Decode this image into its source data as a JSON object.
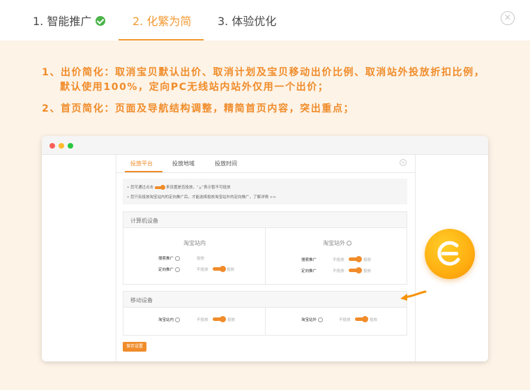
{
  "steps": [
    {
      "label": "1. 智能推广",
      "state": "done"
    },
    {
      "label": "2. 化繁为简",
      "state": "active"
    },
    {
      "label": "3. 体验优化",
      "state": "pending"
    }
  ],
  "close_glyph": "×",
  "description": {
    "line1": "1、出价简化：取消宝贝默认出价、取消计划及宝贝移动出价比例、取消站外投放折扣比例，",
    "line1_cont": "默认使用100%，定向PC无线站内站外仅用一个出价；",
    "line2": "2、首页简化：页面及导航结构调整，精简首页内容，突出重点；"
  },
  "panel": {
    "tabs": [
      "投放平台",
      "投放地域",
      "投放时间"
    ],
    "active_tab": 0,
    "notice": {
      "line1_a": "您可通过点击",
      "line1_b": "来设置是否投放，“",
      "line1_c": "”表示暂不可投放",
      "line2": "您只有投放淘宝站内的定向推广后，才能选择投放淘宝站外的定向推广，了解详情 >>"
    },
    "pc_section": {
      "title": "计算机设备",
      "left_title": "淘宝站内",
      "right_title": "淘宝站外",
      "left_rows": [
        {
          "label": "搜索推广",
          "off": "",
          "on": "投放"
        },
        {
          "label": "定向推广",
          "off": "不投放",
          "on": "投放"
        }
      ],
      "right_rows": [
        {
          "label": "搜索推广",
          "off": "不投放",
          "on": "投放"
        },
        {
          "label": "定向推广",
          "off": "不投放",
          "on": "投放"
        }
      ]
    },
    "mobile_section": {
      "title": "移动设备",
      "left_row": {
        "label": "淘宝站内",
        "off": "不投放",
        "on": "投放"
      },
      "right_row": {
        "label": "淘宝站外",
        "off": "不投放",
        "on": "投放"
      }
    },
    "save_label": "保存设置"
  },
  "colors": {
    "accent": "#f08c2a",
    "background": "#fdf3e7",
    "check": "#4bb44b"
  },
  "icons": [
    "check-icon",
    "close-icon",
    "question-icon",
    "badge-logo-icon",
    "arrow-icon"
  ]
}
